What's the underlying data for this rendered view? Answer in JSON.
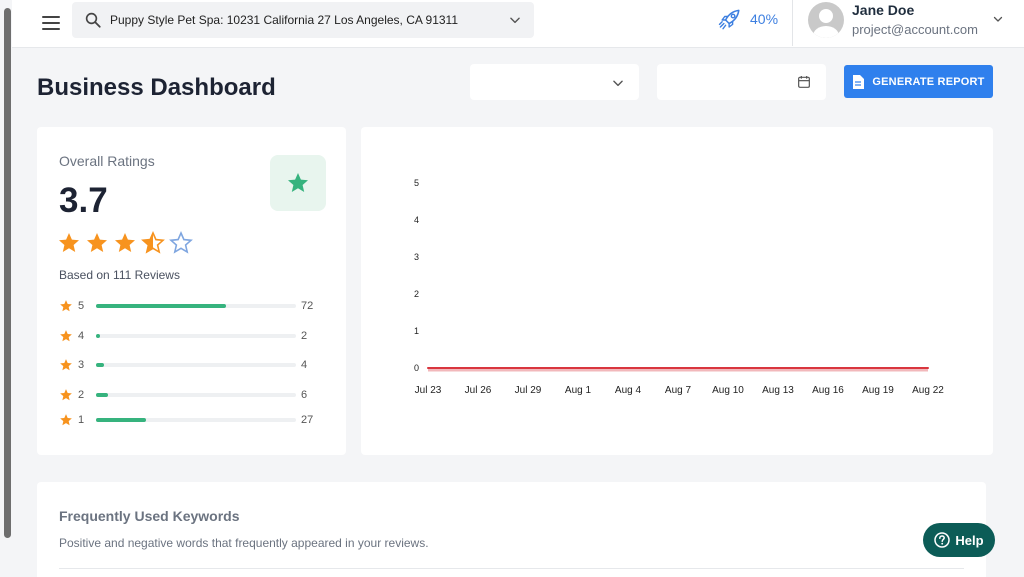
{
  "header": {
    "search": {
      "value": "Puppy Style Pet Spa: 10231 California 27 Los Angeles, CA 91311"
    },
    "progress_text": "40%",
    "user": {
      "name": "Jane Doe",
      "email": "project@account.com"
    }
  },
  "page": {
    "title": "Business Dashboard",
    "generate_report_label": "GENERATE REPORT"
  },
  "ratings": {
    "title": "Overall Ratings",
    "value": "3.7",
    "stars_filled": 3.5,
    "stars_total": 5,
    "reviews_text": "Based on 111 Reviews",
    "distribution": [
      {
        "label": "5",
        "count": "72",
        "fraction": 0.65
      },
      {
        "label": "4",
        "count": "2",
        "fraction": 0.02
      },
      {
        "label": "3",
        "count": "4",
        "fraction": 0.04
      },
      {
        "label": "2",
        "count": "6",
        "fraction": 0.06
      },
      {
        "label": "1",
        "count": "27",
        "fraction": 0.25
      }
    ]
  },
  "chart_data": {
    "type": "line",
    "title": "",
    "xlabel": "",
    "ylabel": "",
    "categories": [
      "Jul 23",
      "Jul 26",
      "Jul 29",
      "Aug 1",
      "Aug 4",
      "Aug 7",
      "Aug 10",
      "Aug 13",
      "Aug 16",
      "Aug 19",
      "Aug 22"
    ],
    "ylim": [
      0,
      5
    ],
    "yticks": [
      "0",
      "1",
      "2",
      "3",
      "4",
      "5"
    ],
    "series": [
      {
        "values": [
          0,
          0,
          0,
          0,
          0,
          0,
          0,
          0,
          0,
          0,
          0
        ],
        "color": "#d9363e"
      }
    ],
    "grid": false
  },
  "keywords": {
    "title": "Frequently Used Keywords",
    "subtitle": "Positive and negative words that frequently appeared in your reviews."
  },
  "help_label": "Help",
  "colors": {
    "accent": "#2f80ed",
    "star": "#f7931e",
    "bar": "#36b37e",
    "help": "#0c5c57",
    "line": "#d9363e"
  }
}
